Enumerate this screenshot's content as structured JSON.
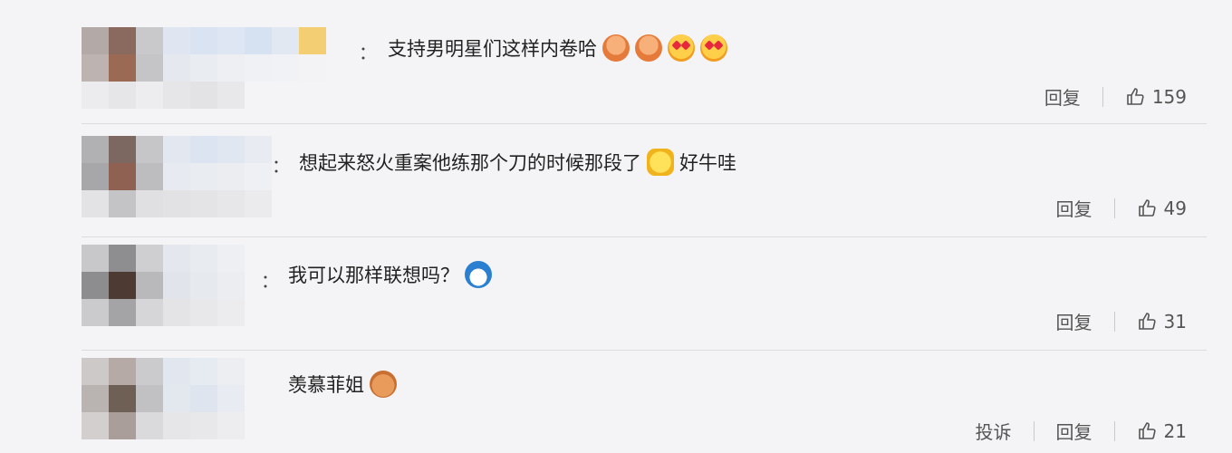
{
  "comments": [
    {
      "text": "支持男明星们这样内卷哈",
      "emojis": [
        "pray-icon",
        "pray-icon",
        "heart-eyes-icon",
        "heart-eyes-icon"
      ],
      "actions": [
        "回复"
      ],
      "likes": "159"
    },
    {
      "text": "想起来怒火重案他练那个刀的时候那段了",
      "text_after": "好牛哇",
      "emojis": [
        "star-face-icon"
      ],
      "actions": [
        "回复"
      ],
      "likes": "49"
    },
    {
      "text": "我可以那样联想吗？",
      "emojis": [
        "doraemon-icon"
      ],
      "actions": [
        "回复"
      ],
      "likes": "31"
    },
    {
      "text": "羡慕菲姐",
      "emojis": [
        "jerry-icon"
      ],
      "actions": [
        "投诉",
        "回复"
      ],
      "likes": "21"
    }
  ],
  "colon": "："
}
